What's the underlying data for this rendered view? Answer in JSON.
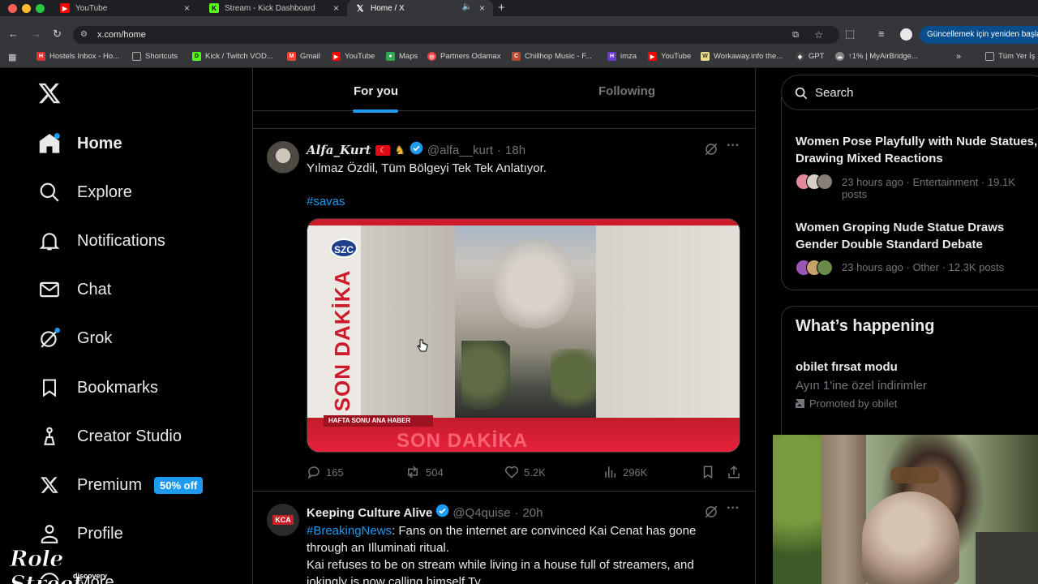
{
  "browser": {
    "tabs": [
      {
        "label": "YouTube",
        "icon": "youtube-icon"
      },
      {
        "label": "Stream - Kick Dashboard",
        "icon": "kick-icon"
      },
      {
        "label": "Home / X",
        "icon": "x-logo-icon"
      }
    ],
    "url": "x.com/home",
    "update_label": "Güncellemek için yeniden başlat",
    "bookmarks": [
      "Hostels Inbox - Ho...",
      "Shortcuts",
      "Kick / Twitch VOD...",
      "Gmail",
      "YouTube",
      "Maps",
      "Partners Odamax",
      "Chillhop Music - F...",
      "imza",
      "YouTube",
      "Workaway.info the...",
      "GPT",
      "↑1% | MyAirBridge...",
      "Tüm Yer İş"
    ]
  },
  "nav": {
    "items": [
      {
        "label": "Home",
        "icon": "home-icon"
      },
      {
        "label": "Explore",
        "icon": "search-icon"
      },
      {
        "label": "Notifications",
        "icon": "bell-icon"
      },
      {
        "label": "Chat",
        "icon": "envelope-icon"
      },
      {
        "label": "Grok",
        "icon": "grok-icon"
      },
      {
        "label": "Bookmarks",
        "icon": "bookmark-icon"
      },
      {
        "label": "Creator Studio",
        "icon": "creator-icon"
      },
      {
        "label": "Premium",
        "icon": "x-logo-icon"
      },
      {
        "label": "Profile",
        "icon": "person-icon"
      },
      {
        "label": "More",
        "icon": "more-icon"
      }
    ],
    "premium_badge": "50% off"
  },
  "feed": {
    "tabs": [
      "For you",
      "Following"
    ],
    "posts": [
      {
        "display_name": "Alfa_Kurt",
        "handle": "@alfa__kurt",
        "sep": "·",
        "time": "18h",
        "text": "Yılmaz Özdil, Tüm Bölgeyi Tek Tek Anlatıyor.",
        "hashtag": "#savas",
        "media": {
          "channel_logo": "SZC",
          "banner_vertical": "SON DAKİKA",
          "lower_strip": "HAFTA SONU ANA HABER",
          "lower_big": "SON DAKİKA"
        },
        "replies": "165",
        "reposts": "504",
        "likes": "5.2K",
        "views": "296K"
      },
      {
        "display_name": "Keeping Culture Alive",
        "handle": "@Q4quise",
        "sep": "·",
        "time": "20h",
        "avatar_text": "KCA",
        "text_tag": "#BreakingNews",
        "text_line1": ": Fans on the internet are convinced Kai Cenat has gone",
        "text_line2": "through an Illuminati ritual.",
        "text_line3": "Kai refuses to be on stream while living in a house full of streamers, and",
        "text_line4": "jokingly is now calling himself Ty."
      }
    ]
  },
  "sidebar": {
    "search_placeholder": "Search",
    "trends": [
      {
        "title": "Women Pose Playfully with Nude Statues, Drawing Mixed Reactions",
        "meta": "23 hours ago · Entertainment · 19.1K posts"
      },
      {
        "title": "Women Groping Nude Statue Draws Gender Double Standard Debate",
        "meta": "23 hours ago · Other · 12.3K posts"
      }
    ],
    "happening_title": "What’s happening",
    "promo": {
      "title": "obilet fırsat modu",
      "subtitle": "Ayın 1'ine özel indirimler",
      "promoted": "Promoted by obilet"
    }
  },
  "watermark": {
    "main": "Role Street",
    "sub": "discovery"
  },
  "colors": {
    "accent": "#1d9bf0",
    "bg": "#000000",
    "border": "#2f3336",
    "muted": "#71767b"
  }
}
